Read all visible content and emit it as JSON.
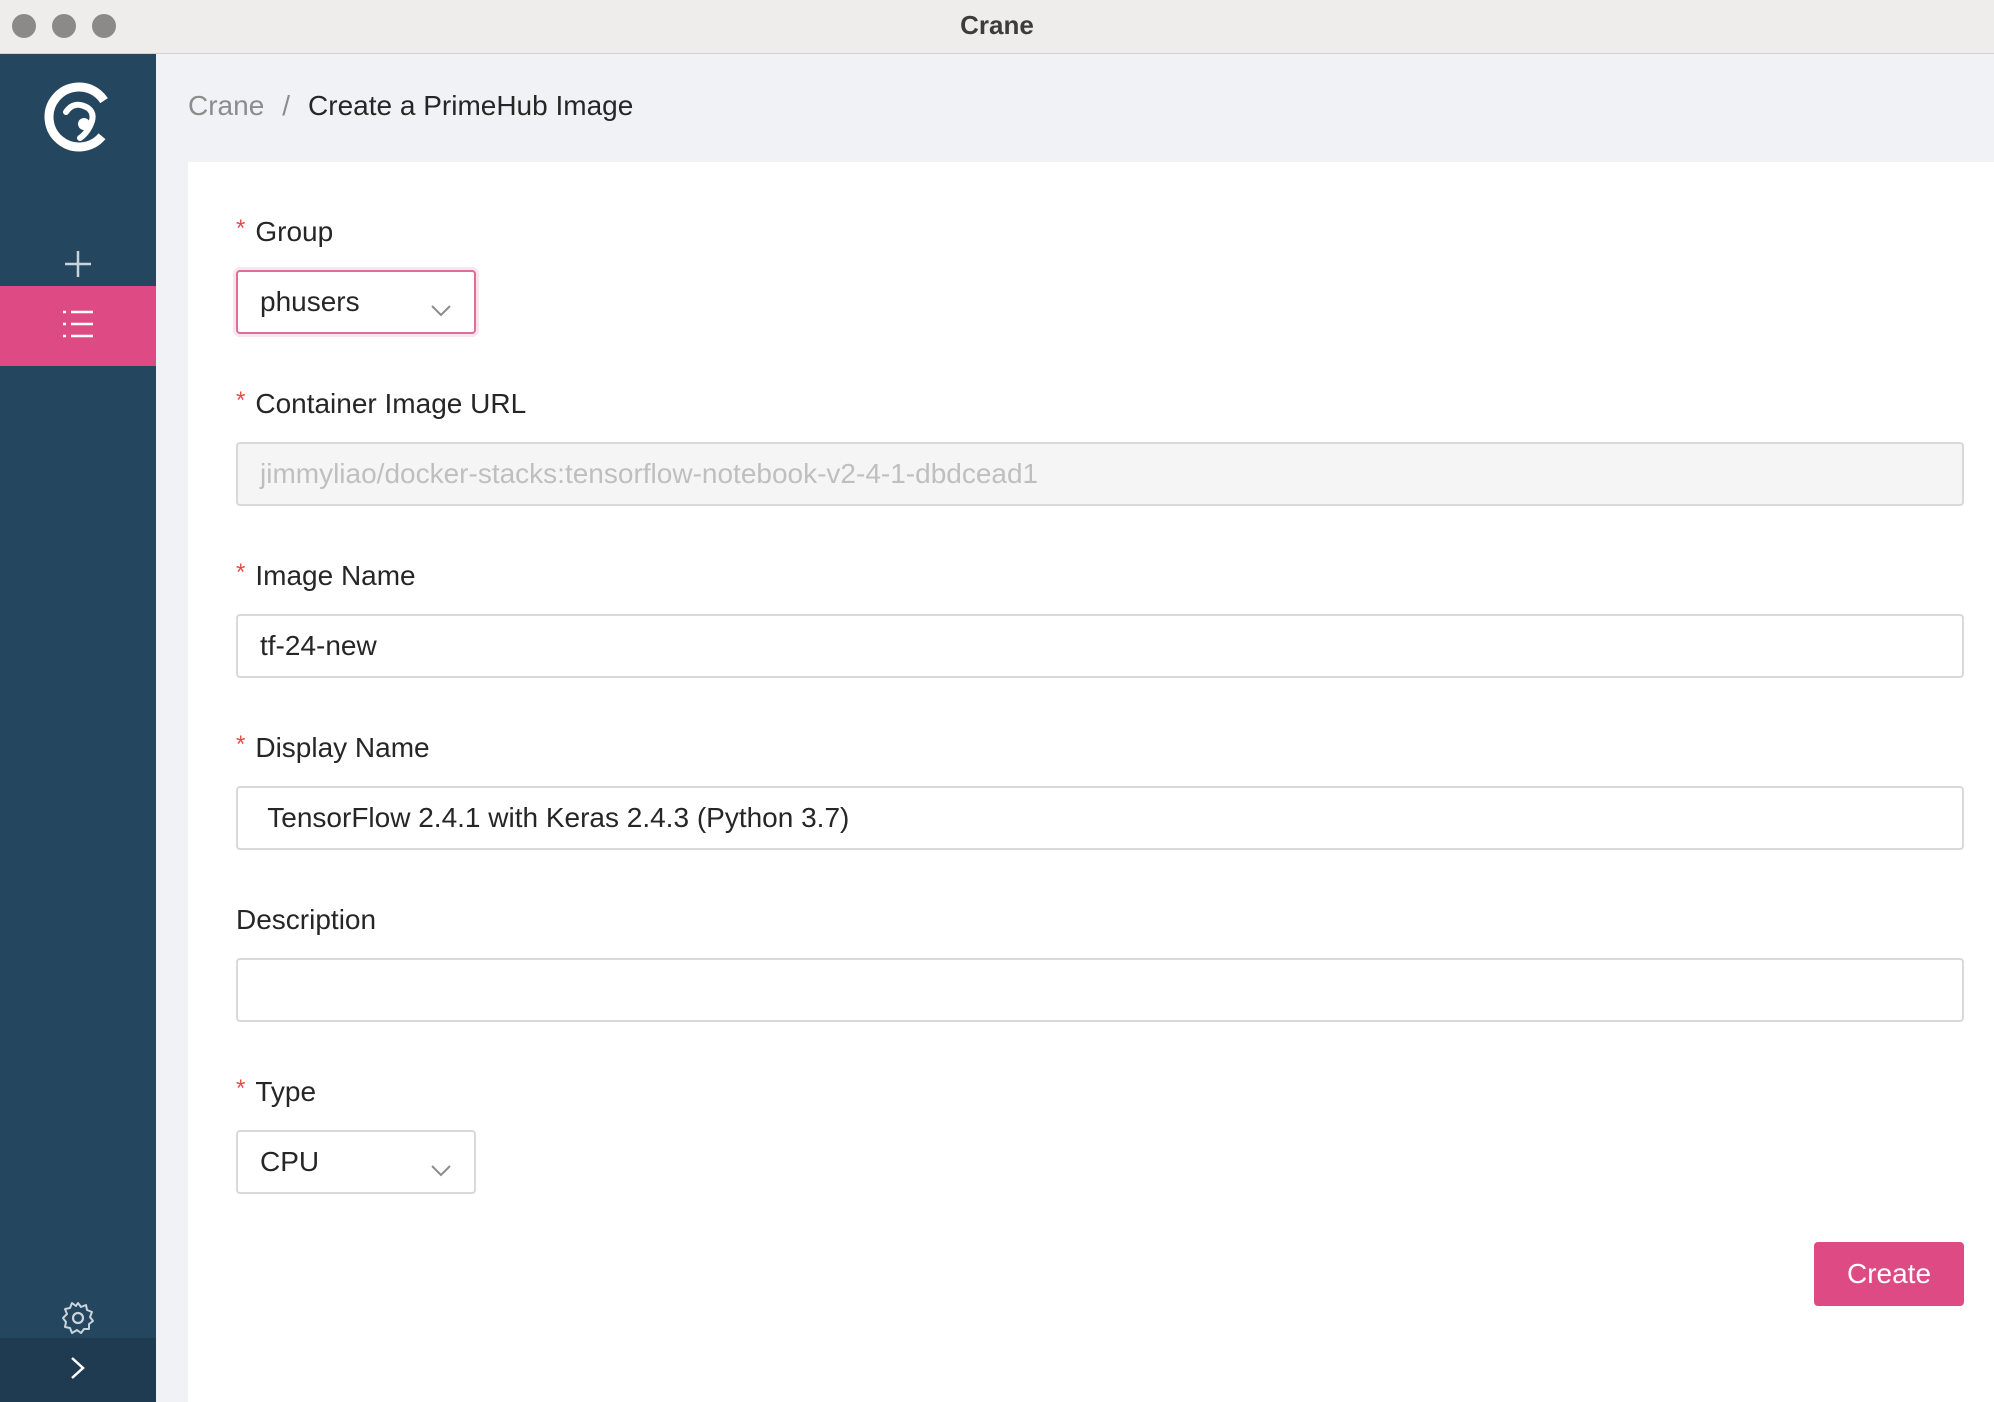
{
  "window": {
    "title": "Crane"
  },
  "sidebar": {
    "items": [
      {
        "icon": "plus-icon",
        "active": false
      },
      {
        "icon": "list-icon",
        "active": true
      },
      {
        "icon": "gear-icon",
        "active": false
      }
    ],
    "collapse_icon": "chevron-right-icon"
  },
  "breadcrumb": {
    "root": "Crane",
    "separator": "/",
    "current": "Create a PrimeHub Image"
  },
  "form": {
    "group": {
      "label": "Group",
      "required": true,
      "value": "phusers"
    },
    "container_image_url": {
      "label": "Container Image URL",
      "required": true,
      "placeholder": "jimmyliao/docker-stacks:tensorflow-notebook-v2-4-1-dbdcead1",
      "disabled": true
    },
    "image_name": {
      "label": "Image Name",
      "required": true,
      "value": "tf-24-new"
    },
    "display_name": {
      "label": "Display Name",
      "required": true,
      "value": " TensorFlow 2.4.1 with Keras 2.4.3 (Python 3.7)"
    },
    "description": {
      "label": "Description",
      "required": false,
      "value": ""
    },
    "type": {
      "label": "Type",
      "required": true,
      "value": "CPU"
    },
    "required_mark": "*",
    "submit_label": "Create"
  },
  "colors": {
    "accent": "#de4a83",
    "sidebar": "#25465f",
    "required": "#e84b4b"
  }
}
